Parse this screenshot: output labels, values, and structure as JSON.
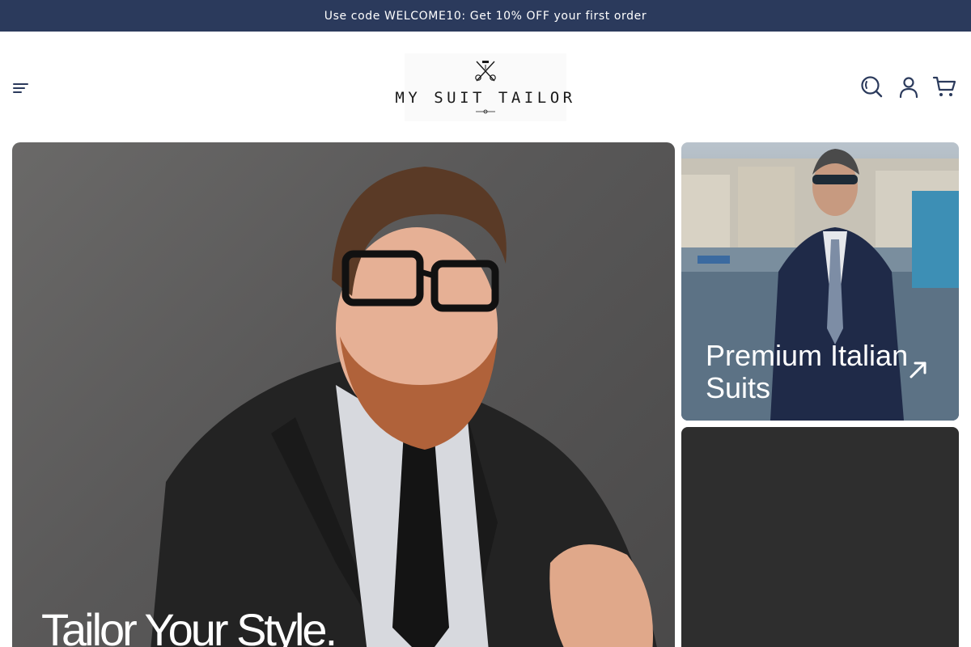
{
  "announcement": {
    "text": "Use code WELCOME10: Get 10% OFF your first order"
  },
  "header": {
    "logo_text": "MY SUIT TAILOR",
    "menu_icon": "menu-icon",
    "search_icon": "search-icon",
    "account_icon": "user-icon",
    "cart_icon": "cart-icon"
  },
  "hero": {
    "title": "Tailor Your Style."
  },
  "cards": [
    {
      "title": "Premium Italian Suits",
      "icon": "arrow-up-right-icon"
    },
    {
      "title": ""
    }
  ],
  "colors": {
    "announcement_bg": "#2b3a5c",
    "header_icon": "#2b3a5c",
    "text_light": "#ffffff",
    "dark_card": "#2e2e2e"
  }
}
